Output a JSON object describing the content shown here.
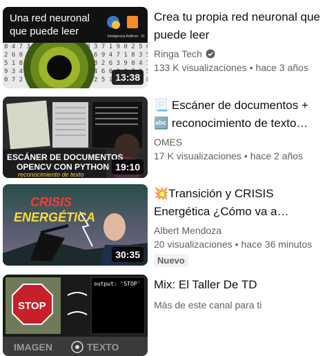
{
  "videos": [
    {
      "thumb_text": [
        "Una red neuronal",
        "que puede leer"
      ],
      "thumb_corner": "Inteligencia Artificial · 01",
      "duration": "13:38",
      "title": "Crea tu propia red neuronal que puede leer",
      "channel": "Ringa Tech",
      "verified": true,
      "views": "133 K visualizaciones",
      "age": "hace 3 años"
    },
    {
      "thumb_text": [
        "ESCÁNER DE DOCUMENTOS",
        "OPENCV CON PYTHON",
        "reconocimiento de texto"
      ],
      "duration": "19:10",
      "title_icon_1": "📃",
      "title_line_1": "Escáner de documentos +",
      "title_icon_2": "🔤",
      "title_line_2": "reconocimiento de texto…",
      "channel": "OMES",
      "views": "17 K visualizaciones",
      "age": "hace 2 años"
    },
    {
      "thumb_text": [
        "CRISIS",
        "ENERGÉTICA"
      ],
      "duration": "30:35",
      "title_icon": "💥",
      "title_line_1": "Transición y CRISIS",
      "title_line_2": "Energética ¿Cómo va a…",
      "channel": "Albert Mendoza",
      "views": "20 visualizaciones",
      "age": "hace 36 minutos",
      "badge": "Nuevo"
    },
    {
      "thumb_text": [
        "STOP",
        "output: 'STOP'",
        "IMAGEN",
        "TEXTO"
      ],
      "title": "Mix: El Taller De TD",
      "subtitle": "Más de este canal para ti"
    }
  ],
  "colors": {
    "primary_text": "#0f0f0f",
    "secondary_text": "#606060",
    "badge_bg": "#f2f2f2"
  }
}
